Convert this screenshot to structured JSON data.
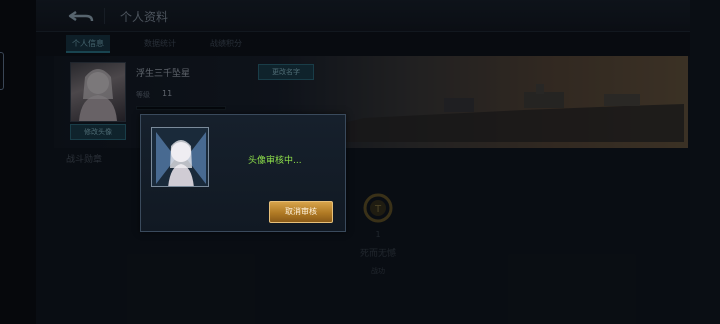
{
  "header": {
    "title": "个人资料"
  },
  "tabs": [
    {
      "label": "个人信息",
      "active": true
    },
    {
      "label": "数据统计",
      "active": false
    },
    {
      "label": "战绩积分",
      "active": false
    }
  ],
  "profile": {
    "name": "浮生三千坠星",
    "rename_label": "更改名字",
    "level_label": "等级",
    "level_value": "11",
    "edit_avatar_label": "修改头像"
  },
  "section": {
    "battle_medals": "战斗勋章"
  },
  "medal": {
    "count": "1",
    "name": "死而无憾",
    "footer": "战功"
  },
  "dialog": {
    "status_text": "头像审核中...",
    "cancel_label": "取消审核"
  },
  "colors": {
    "status_green": "#8ee04a",
    "accent_teal": "#2f7d93",
    "button_gold": "#d7a34a"
  }
}
